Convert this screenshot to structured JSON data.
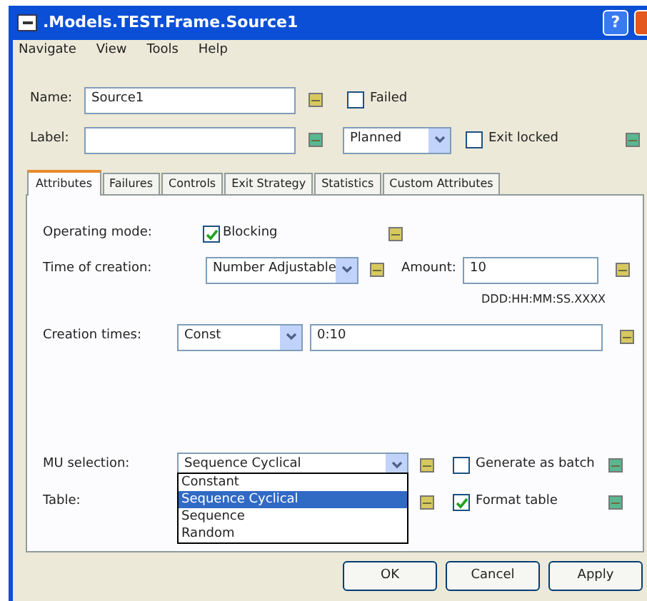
{
  "window": {
    "title": ".Models.TEST.Frame.Source1",
    "help_button": "?"
  },
  "menu": [
    "Navigate",
    "View",
    "Tools",
    "Help"
  ],
  "header": {
    "name": {
      "label": "Name:",
      "value": "Source1",
      "color": "#d8c860"
    },
    "failed": {
      "label": "Failed",
      "checked": false
    },
    "label": {
      "label": "Label:",
      "color": "#58b890"
    },
    "status": {
      "value": "Planned"
    },
    "exit_locked": {
      "label": "Exit locked",
      "checked": false,
      "color": "#58b890"
    }
  },
  "tabs": [
    {
      "label": "Attributes",
      "selected": true
    },
    {
      "label": "Failures",
      "selected": false
    },
    {
      "label": "Controls",
      "selected": false
    },
    {
      "label": "Exit Strategy",
      "selected": false
    },
    {
      "label": "Statistics",
      "selected": false
    },
    {
      "label": "Custom Attributes",
      "selected": false
    }
  ],
  "attributes": {
    "operating_mode": {
      "label": "Operating mode:",
      "checkbox": "Blocking",
      "checked": true,
      "color": "#d8c860"
    },
    "time_of_creation": {
      "label": "Time of creation:",
      "value": "Number Adjustable",
      "color": "#d8c860"
    },
    "amount": {
      "label": "Amount:",
      "value": "10",
      "color": "#d8c860"
    },
    "time_format": "DDD:HH:MM:SS.XXXX",
    "creation_times": {
      "label": "Creation times:",
      "value": "Const",
      "time": "0:10",
      "color": "#d8c860"
    },
    "mu_selection": {
      "label": "MU selection:",
      "value": "Sequence Cyclical",
      "color": "#d8c860"
    },
    "generate_as_batch": {
      "label": "Generate as batch",
      "checked": false,
      "color": "#58b890"
    },
    "table": {
      "label": "Table:",
      "color": "#d8c860"
    },
    "format_table": {
      "label": "Format table",
      "checked": true,
      "color": "#58b890"
    },
    "dropdown_options": [
      {
        "label": "Constant",
        "selected": false
      },
      {
        "label": "Sequence Cyclical",
        "selected": true
      },
      {
        "label": "Sequence",
        "selected": false
      },
      {
        "label": "Random",
        "selected": false
      }
    ]
  },
  "buttons": [
    "OK",
    "Cancel",
    "Apply"
  ]
}
